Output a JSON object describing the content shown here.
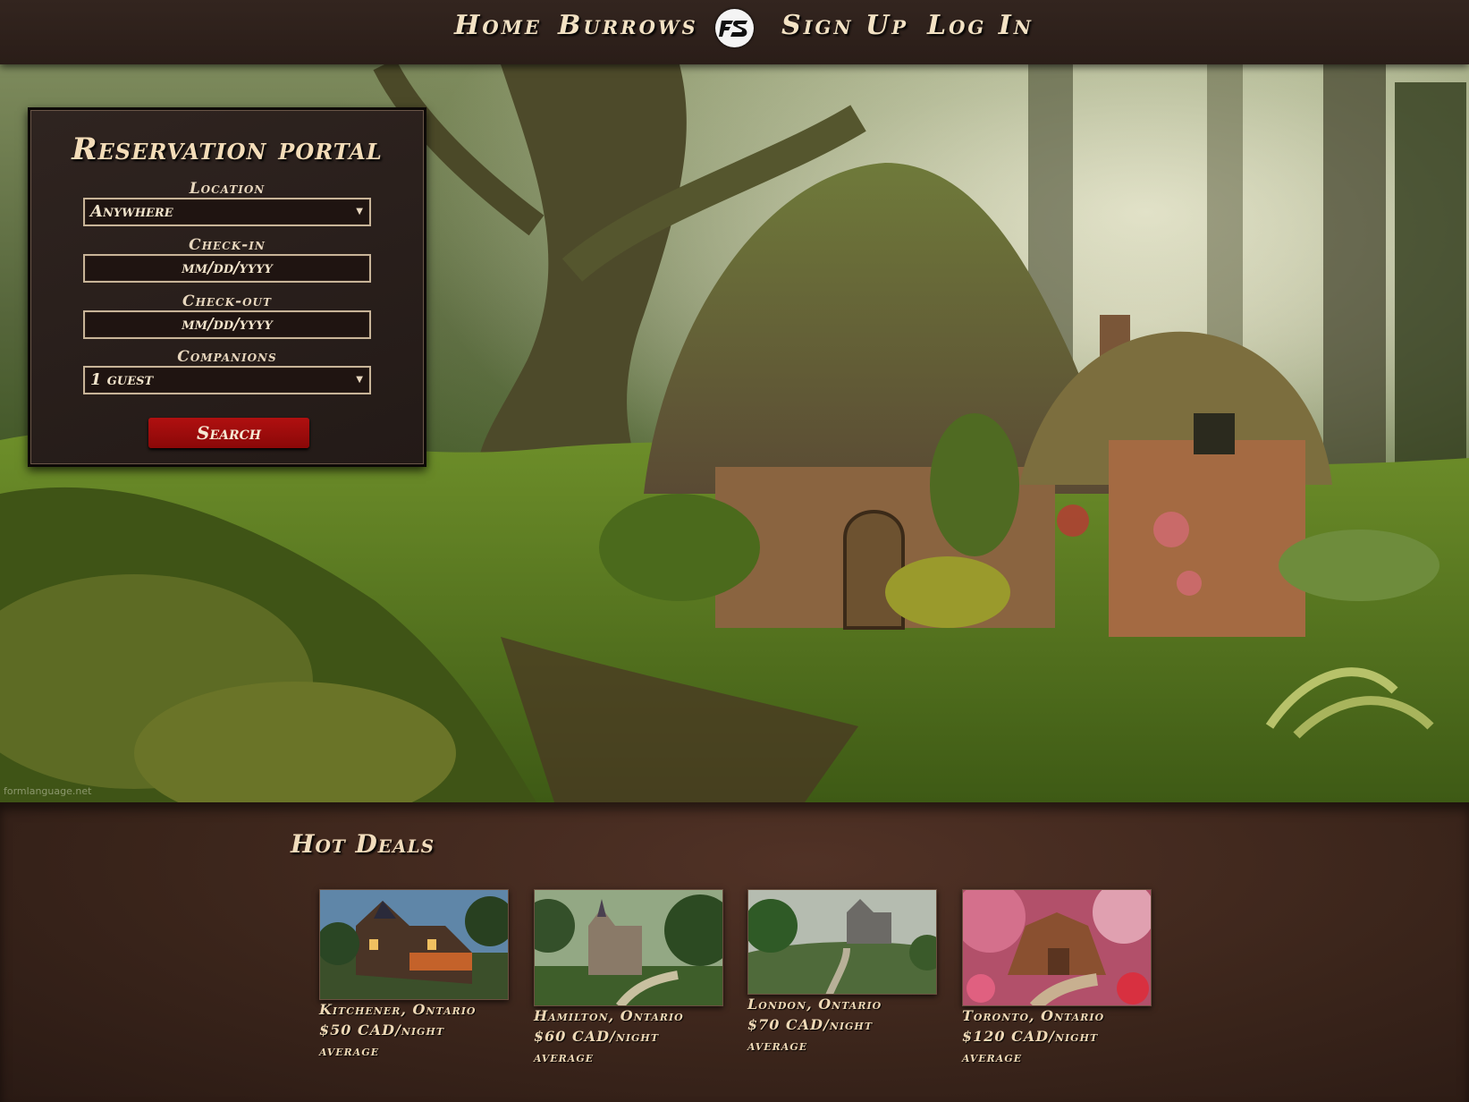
{
  "nav": {
    "home": "Home",
    "burrows": "Burrows",
    "logo_text": "FS",
    "signup": "Sign Up",
    "login": "Log In"
  },
  "hero": {
    "watermark": "formlanguage.net"
  },
  "reservation": {
    "title": "Reservation portal",
    "location_label": "Location",
    "location_value": "Anywhere",
    "checkin_label": "Check-in",
    "checkin_placeholder": "mm/dd/yyyy",
    "checkout_label": "Check-out",
    "checkout_placeholder": "mm/dd/yyyy",
    "companions_label": "Companions",
    "companions_value": "1 guest",
    "search_label": "Search"
  },
  "deals": {
    "title": "Hot Deals",
    "items": [
      {
        "location": "Kitchener, Ontario",
        "price": "$50 CAD/night",
        "note": "average"
      },
      {
        "location": "Hamilton, Ontario",
        "price": "$60 CAD/night",
        "note": "average"
      },
      {
        "location": "London, Ontario",
        "price": "$70 CAD/night",
        "note": "average"
      },
      {
        "location": "Toronto, Ontario",
        "price": "$120 CAD/night",
        "note": "average"
      }
    ]
  }
}
